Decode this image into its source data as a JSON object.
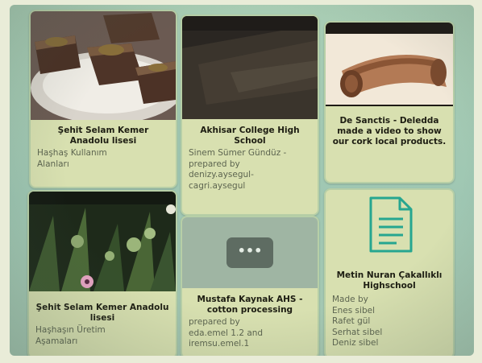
{
  "cards": [
    {
      "title": "Şehit Selam Kemer Anadolu lisesi",
      "desc": [
        "Haşhaş Kullanım",
        "Alanları"
      ]
    },
    {
      "title": "Akhisar College High School",
      "desc": [
        "Sinem Sümer Gündüz -",
        "prepared by",
        "denizy.aysegul-",
        "cagri.aysegul"
      ]
    },
    {
      "title": "De Sanctis - Deledda made a video to show our cork local products.",
      "desc": []
    },
    {
      "title": "Şehit Selam Kemer Anadolu lisesi",
      "desc": [
        "Haşhaşın Üretim",
        "Aşamaları"
      ]
    },
    {
      "title": "Mustafa Kaynak AHS - cotton processing",
      "desc": [
        "prepared by",
        "eda.emel 1.2 and",
        "iremsu.emel.1"
      ],
      "button_glyph": "•••"
    },
    {
      "title": "Metin Nuran Çakallıklı Highschool",
      "desc": [
        "Made by",
        "Enes sibel",
        "Rafet gül",
        "Serhat sibel",
        "Deniz sibel"
      ],
      "icon": "document-icon"
    }
  ],
  "colors": {
    "background": "#a9cdb4",
    "card": "#d8e0b0",
    "icon_teal": "#26a690"
  }
}
